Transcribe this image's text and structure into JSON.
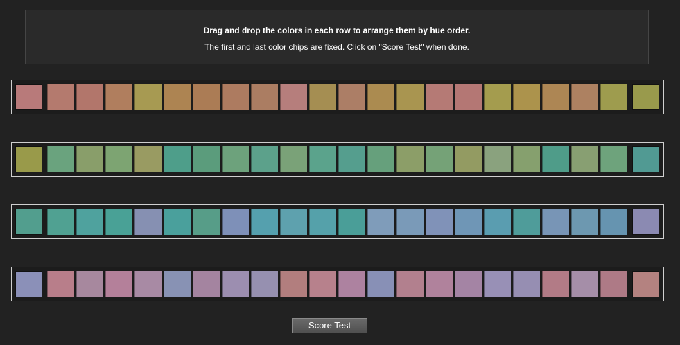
{
  "instructions": {
    "title": "Drag and drop the colors in each row to arrange them by hue order.",
    "subtitle": "The first and last color chips are fixed. Click on \"Score Test\" when done."
  },
  "rows": [
    {
      "name": "row-1",
      "chips": [
        "#b87a7a",
        "#b47a6e",
        "#b2766b",
        "#b07e5e",
        "#a79a52",
        "#ad8452",
        "#ab7c55",
        "#ad7b60",
        "#ab7d62",
        "#b67e7c",
        "#a58e52",
        "#ac7e66",
        "#ab8b50",
        "#a99550",
        "#b57a75",
        "#b47774",
        "#a49c4e",
        "#ac934c",
        "#ad8654",
        "#ad8161",
        "#9e9c4e",
        "#999a4c"
      ]
    },
    {
      "name": "row-2",
      "chips": [
        "#999a4a",
        "#6aa37e",
        "#899e6a",
        "#7da472",
        "#999b62",
        "#4e9e8a",
        "#5b9c7c",
        "#6da27c",
        "#5ca18b",
        "#7aa278",
        "#5ba38c",
        "#559e8e",
        "#66a07c",
        "#8c9e68",
        "#75a277",
        "#939b62",
        "#8aa27e",
        "#86a06e",
        "#4f9c89",
        "#889f72",
        "#6ea37c",
        "#519a93"
      ]
    },
    {
      "name": "row-3",
      "chips": [
        "#529e8e",
        "#50a192",
        "#4fa29e",
        "#49a196",
        "#8690b2",
        "#4aa09c",
        "#579d88",
        "#7e90b8",
        "#55a0ae",
        "#5ea1ae",
        "#55a1aa",
        "#4a9e98",
        "#7f9cba",
        "#7a9ab8",
        "#8092b8",
        "#6f96b6",
        "#5a9db0",
        "#4f9c9a",
        "#7895b6",
        "#6d98b0",
        "#6694b0",
        "#8b8ab2"
      ]
    },
    {
      "name": "row-4",
      "chips": [
        "#8b90b8",
        "#b87e8a",
        "#a7889e",
        "#b4809a",
        "#a88aa4",
        "#8892b4",
        "#a484a0",
        "#9c8eb0",
        "#9690b0",
        "#b27e7e",
        "#b7818c",
        "#ad82a0",
        "#8890b6",
        "#b2808e",
        "#b0829c",
        "#a484a4",
        "#9890b6",
        "#968eb2",
        "#b27b86",
        "#a58ea8",
        "#ae7a86",
        "#b48280"
      ]
    }
  ],
  "actions": {
    "score_label": "Score Test"
  }
}
